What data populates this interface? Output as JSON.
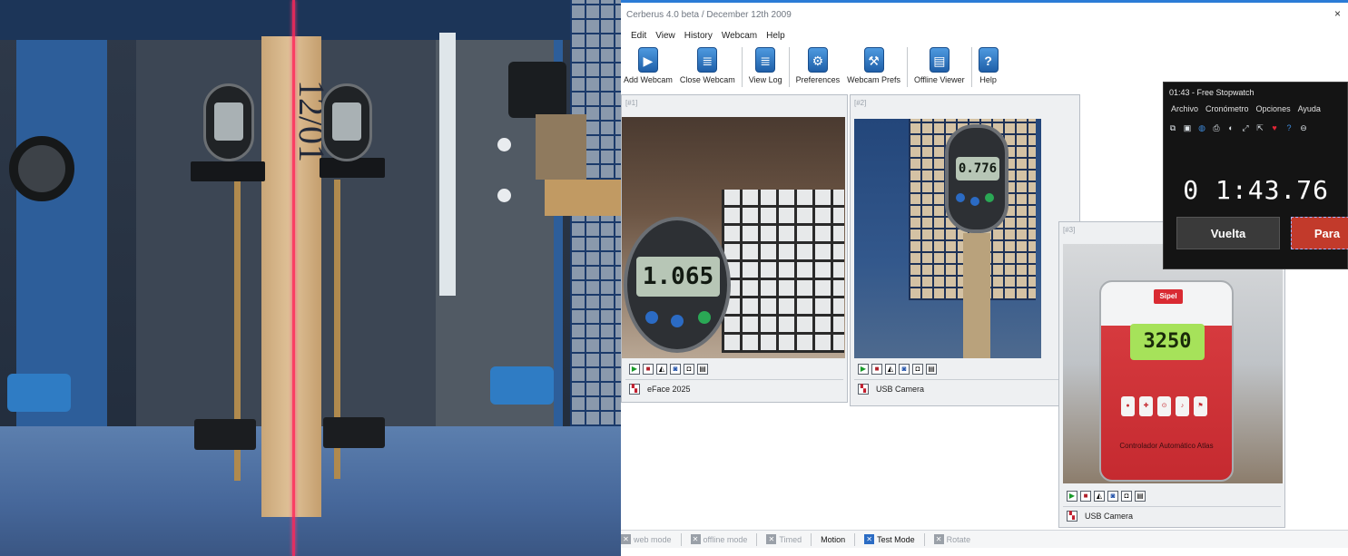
{
  "app": {
    "title": "Cerberus 4.0 beta / December 12th 2009",
    "close_glyph": "×"
  },
  "menu": [
    "Edit",
    "View",
    "History",
    "Webcam",
    "Help"
  ],
  "toolbar": [
    {
      "label": "Add Webcam",
      "icon": "video-camera-icon",
      "glyph": "▶"
    },
    {
      "label": "Close Webcam",
      "icon": "document-icon",
      "glyph": "≣"
    },
    {
      "label": "View Log",
      "icon": "log-icon",
      "glyph": "≣"
    },
    {
      "label": "Preferences",
      "icon": "gear-icon",
      "glyph": "⚙"
    },
    {
      "label": "Webcam Prefs",
      "icon": "wrench-icon",
      "glyph": "⚒"
    },
    {
      "label": "Offline Viewer",
      "icon": "film-icon",
      "glyph": "▤"
    },
    {
      "label": "Help",
      "icon": "help-icon",
      "glyph": "?"
    }
  ],
  "panels": [
    {
      "tag": "[#1]",
      "camera_name": "eFace 2025",
      "gauge_reading": "1.065"
    },
    {
      "tag": "[#2]",
      "camera_name": "USB Camera",
      "gauge_reading": "0.776"
    },
    {
      "tag": "[#3]",
      "camera_name": "USB Camera",
      "display_reading": "3250",
      "logo": "Sipel",
      "device_label": "Controlador Automático Atlas"
    }
  ],
  "status": [
    {
      "label": "web mode",
      "active": false
    },
    {
      "label": "offline mode",
      "active": false
    },
    {
      "label": "Timed",
      "active": false
    },
    {
      "label": "Motion",
      "active": true,
      "no_box": true
    },
    {
      "label": "Test Mode",
      "active": true
    },
    {
      "label": "Rotate",
      "active": false
    }
  ],
  "stopwatch": {
    "title": "01:43 - Free Stopwatch",
    "menu": [
      "Archivo",
      "Cronómetro",
      "Opciones",
      "Ayuda"
    ],
    "time": "0 1:43.76",
    "lap_label": "Vuelta",
    "stop_label": "Para"
  },
  "photo": {
    "marker_text": "12/01"
  },
  "colors": {
    "accent": "#2b7bd6",
    "toolbar_icon": "#1f5fa8",
    "stop_button": "#c23a2b",
    "lcd_green": "#a6e25a"
  }
}
